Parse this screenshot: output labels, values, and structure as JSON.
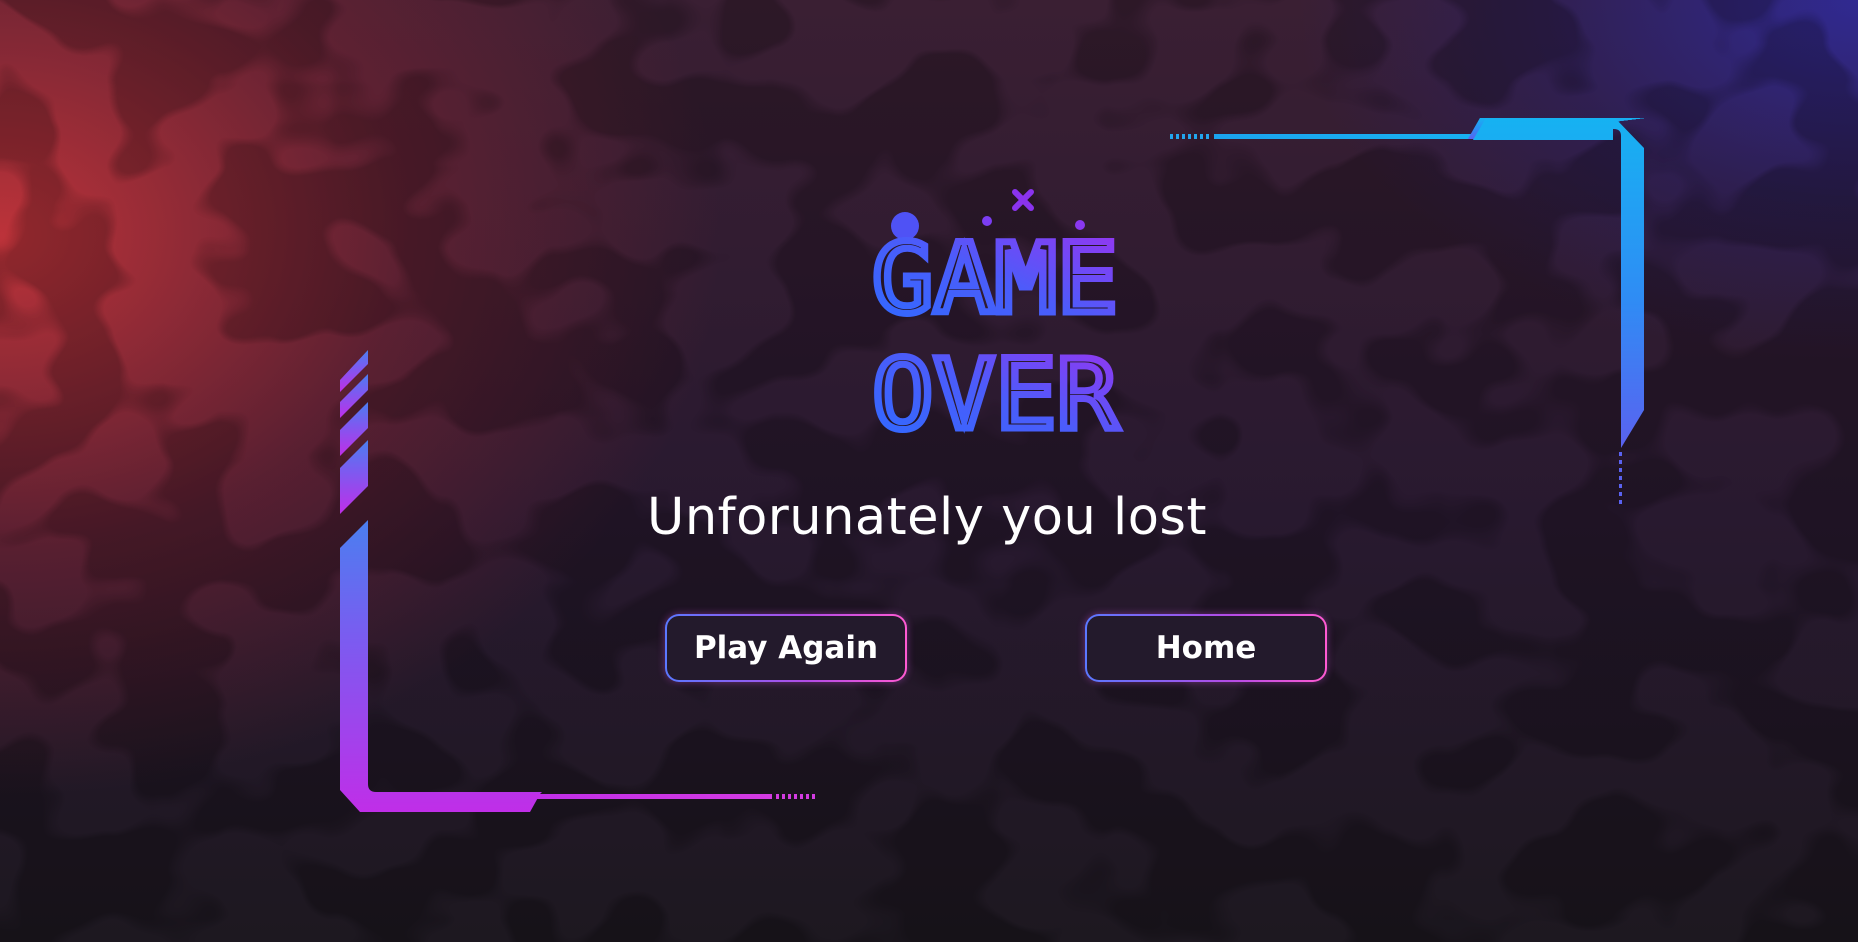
{
  "screen": {
    "logo_line_1": "GAME",
    "logo_line_2": "OVER",
    "subtitle": "Unforunately you lost"
  },
  "buttons": {
    "play_again": "Play Again",
    "home": "Home"
  },
  "colors": {
    "logo_blue": "#2e6bff",
    "logo_purple": "#9b33f0",
    "frame_cyan": "#18b4f2",
    "frame_magenta": "#c02ee8",
    "button_pink": "#ff5ad2",
    "button_blue": "#5a78ff"
  },
  "icons": {
    "logo_dots": "decorative-dots-icon",
    "logo_cross": "cross-icon"
  }
}
